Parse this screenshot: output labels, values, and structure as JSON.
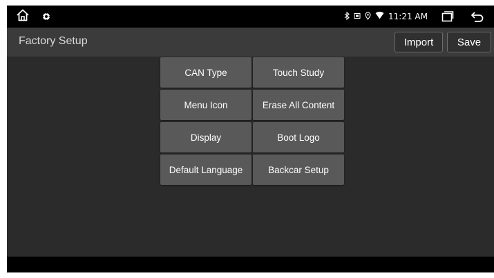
{
  "status_bar": {
    "time": "11:21 AM",
    "icons": [
      "home-icon",
      "settings-gear-icon",
      "bluetooth-icon",
      "sim-icon",
      "location-icon",
      "wifi-icon",
      "recents-icon",
      "back-icon"
    ]
  },
  "header": {
    "title": "Factory Setup",
    "import_label": "Import",
    "save_label": "Save"
  },
  "menu": {
    "items": [
      {
        "label": "CAN Type"
      },
      {
        "label": "Touch Study"
      },
      {
        "label": "Menu Icon"
      },
      {
        "label": "Erase All Content"
      },
      {
        "label": "Display"
      },
      {
        "label": "Boot Logo"
      },
      {
        "label": "Default Language"
      },
      {
        "label": "Backcar Setup"
      }
    ]
  },
  "colors": {
    "background": "#2b2b2b",
    "status_bar": "#000000",
    "title_bar": "#3b3b3b",
    "button": "#595959",
    "text": "#ffffff"
  }
}
